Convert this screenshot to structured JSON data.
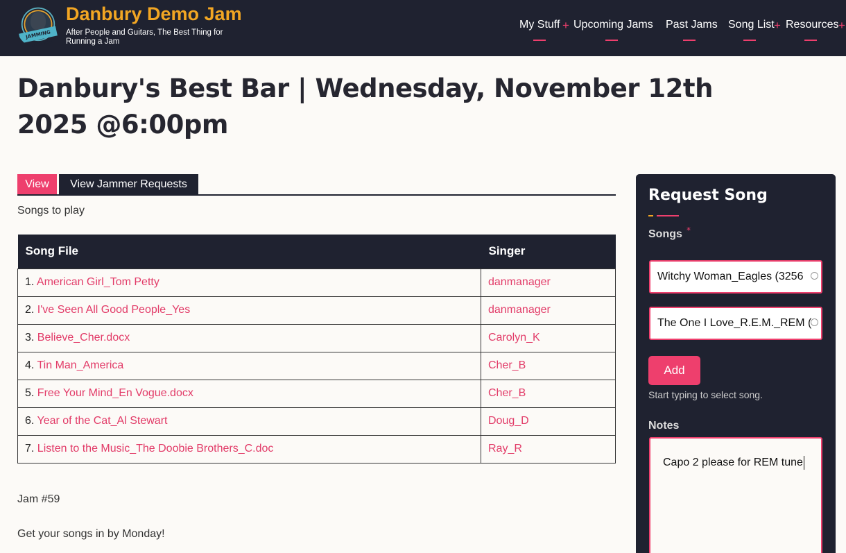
{
  "header": {
    "site_title": "Danbury Demo Jam",
    "tagline": "After People and Guitars, The Best Thing for Running a Jam",
    "logo_text": "JAMMING JUNCTION",
    "nav": [
      {
        "label": "My Stuff",
        "has_submenu": true
      },
      {
        "label": "Upcoming Jams",
        "has_submenu": false
      },
      {
        "label": "Past Jams",
        "has_submenu": false
      },
      {
        "label": "Song List",
        "has_submenu": true
      },
      {
        "label": "Resources",
        "has_submenu": true
      }
    ],
    "plus": "+"
  },
  "page": {
    "title": "Danbury's Best Bar | Wednesday, November 12th 2025 @6:00pm"
  },
  "tabs": {
    "view": "View",
    "requests": "View Jammer Requests"
  },
  "songs_label": "Songs to play",
  "table": {
    "headers": [
      "Song File",
      "Singer"
    ],
    "rows": [
      {
        "num": "1.",
        "song": "American Girl_Tom Petty",
        "singer": "danmanager"
      },
      {
        "num": "2.",
        "song": "I've Seen All Good People_Yes",
        "singer": "danmanager"
      },
      {
        "num": "3.",
        "song": "Believe_Cher.docx",
        "singer": "Carolyn_K"
      },
      {
        "num": "4.",
        "song": "Tin Man_America",
        "singer": "Cher_B"
      },
      {
        "num": "5.",
        "song": "Free Your Mind_En Vogue.docx",
        "singer": "Cher_B"
      },
      {
        "num": "6.",
        "song": "Year of the Cat_Al Stewart",
        "singer": "Doug_D"
      },
      {
        "num": "7.",
        "song": "Listen to the Music_The Doobie Brothers_C.doc",
        "singer": "Ray_R"
      }
    ]
  },
  "jam_number": "Jam #59",
  "jam_note": "Get your songs in by Monday!",
  "request_panel": {
    "title": "Request Song",
    "songs_label": "Songs",
    "required_mark": "*",
    "song_inputs": [
      "Witchy Woman_Eagles (3256",
      "The One I Love_R.E.M._REM ("
    ],
    "add_label": "Add",
    "hint": "Start typing to select song.",
    "notes_label": "Notes",
    "notes_value": "Capo 2 please for REM tune"
  },
  "colors": {
    "accent": "#ee3f6d",
    "brand": "#f2a623",
    "dark": "#1f2230"
  }
}
